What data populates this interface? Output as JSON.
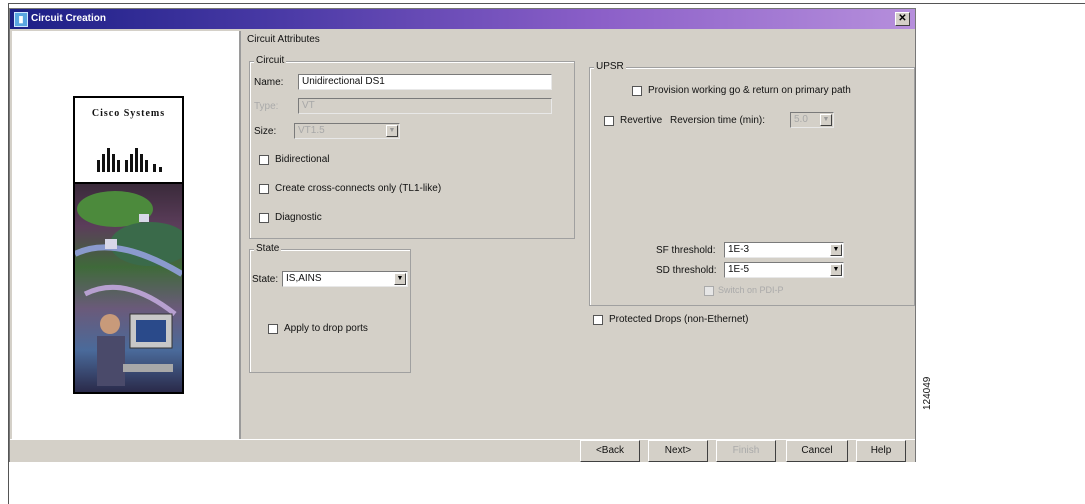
{
  "window": {
    "title": "Circuit Creation"
  },
  "logo": {
    "text": "Cisco Systems"
  },
  "panel_title": "Circuit Attributes",
  "circuit": {
    "group_title": "Circuit",
    "name_label": "Name:",
    "name_value": "Unidirectional DS1",
    "type_label": "Type:",
    "type_value": "VT",
    "size_label": "Size:",
    "size_value": "VT1.5",
    "bidirectional_label": "Bidirectional",
    "cross_connects_label": "Create cross-connects only (TL1-like)",
    "diagnostic_label": "Diagnostic"
  },
  "state": {
    "group_title": "State",
    "state_label": "State:",
    "state_value": "IS,AINS",
    "apply_label": "Apply to drop ports"
  },
  "upsr": {
    "group_title": "UPSR",
    "provision_label": "Provision working go & return on primary path",
    "revertive_label": "Revertive",
    "reversion_label": "Reversion time (min):",
    "reversion_value": "5.0",
    "sf_label": "SF threshold:",
    "sf_value": "1E-3",
    "sd_label": "SD threshold:",
    "sd_value": "1E-5",
    "switch_label": "Switch on PDI-P"
  },
  "protected_drops_label": "Protected Drops (non-Ethernet)",
  "buttons": {
    "back": "<Back",
    "next": "Next>",
    "finish": "Finish",
    "cancel": "Cancel",
    "help": "Help"
  },
  "figure_number": "124049"
}
